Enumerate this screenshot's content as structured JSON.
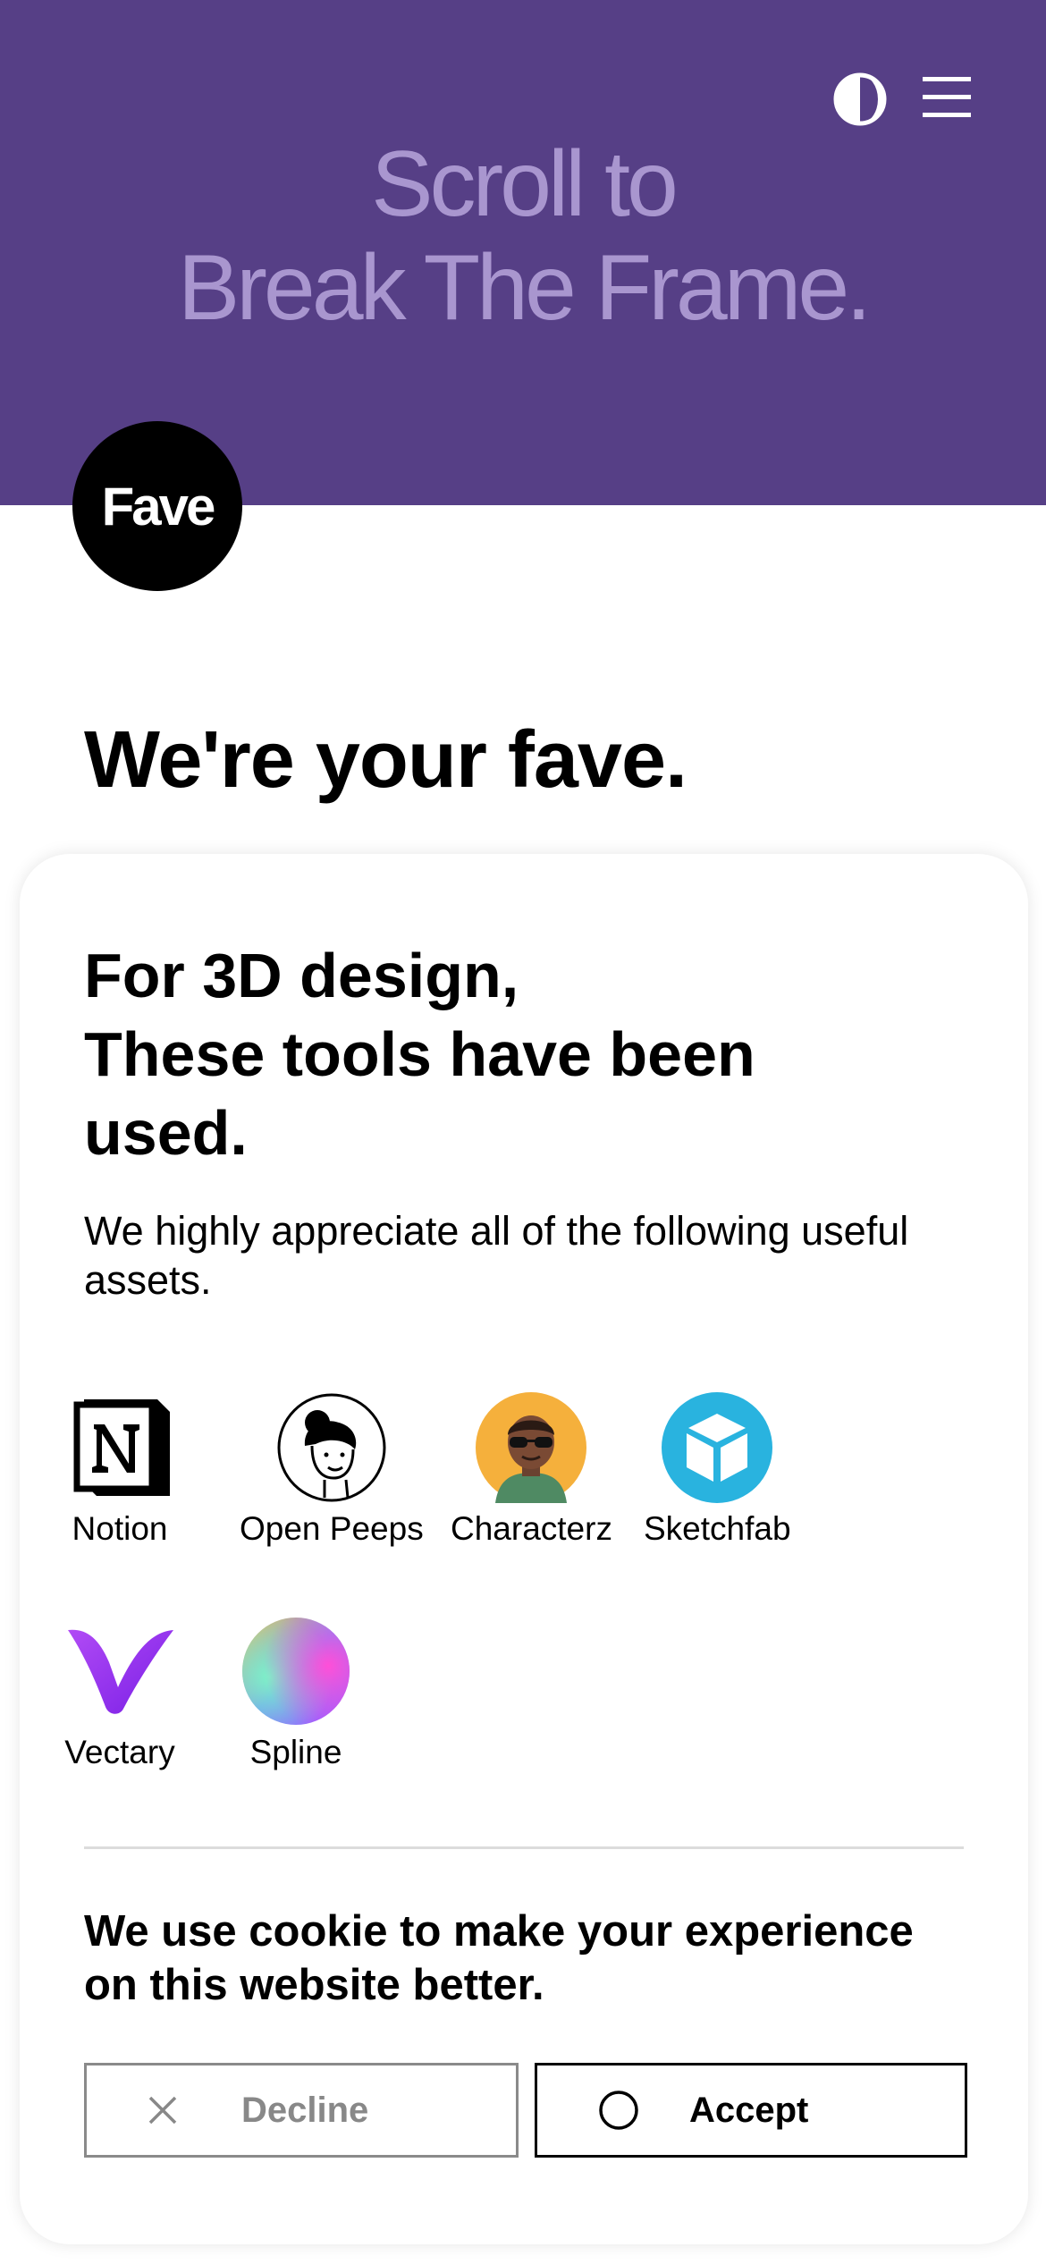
{
  "header": {
    "title_line1": "Scroll to",
    "title_line2": "Break The Frame.",
    "theme_toggle_icon": "half-moon-contrast-icon",
    "menu_icon": "hamburger-menu-icon",
    "background_color": "#563f86",
    "title_color": "#a996cf"
  },
  "logo": {
    "text": "Fave"
  },
  "intro": {
    "headline": "We're your fave."
  },
  "card": {
    "title_line1": "For 3D design,",
    "title_line2": "These tools have been",
    "title_line3": "used.",
    "description": "We highly appreciate all of the following useful assets.",
    "tools": [
      {
        "label": "Notion",
        "icon": "notion-logo-icon"
      },
      {
        "label": "Open Peeps",
        "icon": "open-peeps-avatar-icon"
      },
      {
        "label": "Characterz",
        "icon": "characterz-avatar-icon"
      },
      {
        "label": "Sketchfab",
        "icon": "sketchfab-logo-icon"
      },
      {
        "label": "Vectary",
        "icon": "vectary-logo-icon"
      },
      {
        "label": "Spline",
        "icon": "spline-gradient-orb-icon"
      }
    ]
  },
  "cookie": {
    "message": "We use cookie to make your experience on this website better.",
    "decline_label": "Decline",
    "accept_label": "Accept"
  }
}
